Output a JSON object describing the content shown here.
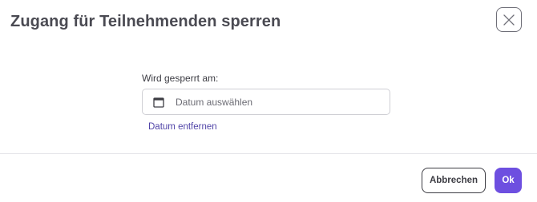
{
  "dialog": {
    "title": "Zugang für Teilnehmenden sperren",
    "close_icon": "close-icon"
  },
  "form": {
    "label": "Wird gesperrt am:",
    "date_placeholder": "Datum auswählen",
    "calendar_icon": "calendar-icon",
    "remove_link": "Datum entfernen"
  },
  "footer": {
    "cancel_label": "Abbrechen",
    "ok_label": "Ok"
  },
  "colors": {
    "primary": "#6d4fe0",
    "link": "#5145a8",
    "title": "#4a4a52"
  }
}
